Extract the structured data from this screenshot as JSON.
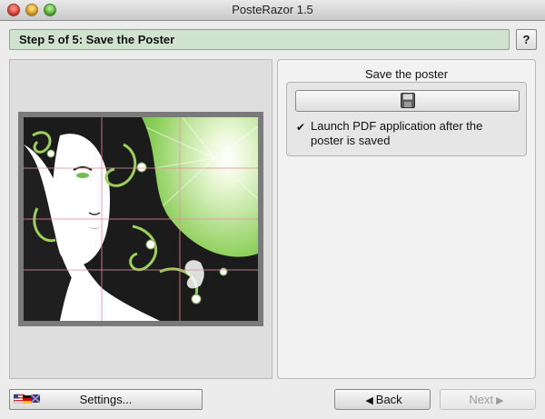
{
  "window": {
    "title": "PosteRazor 1.5"
  },
  "step": {
    "label": "Step 5 of 5: Save the Poster",
    "help_label": "?"
  },
  "save_panel": {
    "title": "Save the poster",
    "save_button_icon": "floppy-disk-icon",
    "launch_pdf_checked": true,
    "launch_pdf_label_line1": "Launch PDF application after the",
    "launch_pdf_label_line2": "poster is saved"
  },
  "footer": {
    "settings_label": "Settings...",
    "back_label": "Back",
    "next_label": "Next",
    "next_enabled": false
  },
  "colors": {
    "step_bar": "#cfe3cf",
    "accent_green": "#7fbf4a"
  }
}
